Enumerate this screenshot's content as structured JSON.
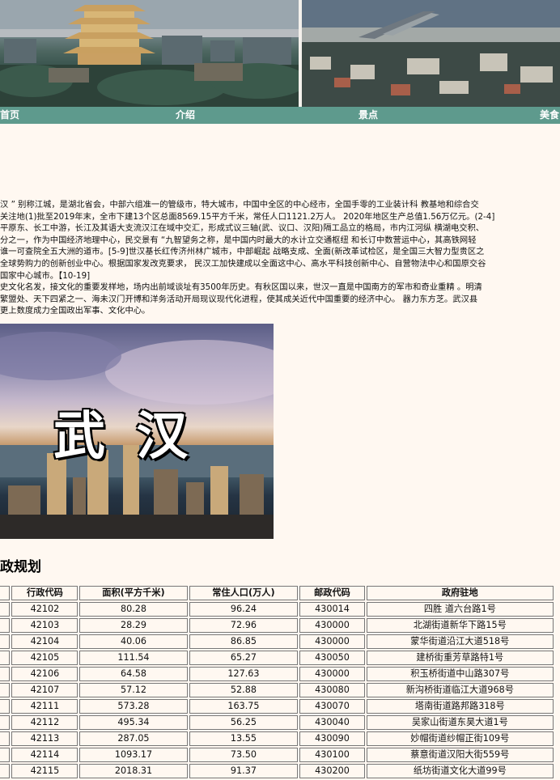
{
  "nav": {
    "items": [
      "首页",
      "介绍",
      "景点",
      "美食"
    ]
  },
  "intro": {
    "lines": [
      "汉 ” 别称江城，是湖北省会，中部六组准一的管级市，特大城市，中国中全区的中心经市，全国手零的工业装计科 教基地和综合交",
      "关注地(1)批至2019年末，全市下建13个区总面8569.15平方千米，常任人口1121.2万人。 2020年地区生产总值1.56万亿元。(2-4]",
      "平原东、长工中游，长江及其语大支流汉江在域中交汇，形成式议三轴(武、议口、汉阳)隔工品立的格局，市内江河纵 横湖电交积、",
      "分之一，作为中国经济地理中心，民交景有 “九智望务之称，是中国内时最大的水计立交通枢纽 和长订中数营运中心，其高铁网轻",
      "谁一可查院全五大洲的道市。[5-9]世汉基长红传济州林广城市，中部崛起 战略支成、全面(新改革试检区，是全国三大智力型贵区之",
      "全球势购力的创新创业中心。根据国家发改克要求， 民汉工加快建成以全面这中心、高水平科技创新中心、自营物法中心和国原交谷",
      "国家中心城市。【10-19]",
      "史文化名发，接文化的重要发样地，场内出前域谈址有3500年历史。有秋区国以来，世汉一直是中国南方的军市和奇业重精 。明清",
      "繁盟处、天下四紧之一、海未汉门开博和洋务活动开局现议现代化进程，使其成关近代中国重要的经济中心。 器力东方芝。武汉县",
      "更上数度成力全国政出军事、文化中心。"
    ]
  },
  "photo": {
    "title": "武 汉"
  },
  "admin": {
    "title": "政规划",
    "headers": [
      "",
      "行政代码",
      "面积(平方千米)",
      "常住人口(万人)",
      "邮政代码",
      "政府驻地"
    ],
    "rows": [
      [
        "",
        "42102",
        "80.28",
        "96.24",
        "430014",
        "四胜 道六台路1号"
      ],
      [
        "",
        "42103",
        "28.29",
        "72.96",
        "430000",
        "北湖街道新华下路15号"
      ],
      [
        "",
        "42104",
        "40.06",
        "86.85",
        "430000",
        "蒙华街道沿江大道518号"
      ],
      [
        "",
        "42105",
        "111.54",
        "65.27",
        "430050",
        "建桥街重芳草路特1号"
      ],
      [
        "",
        "42106",
        "64.58",
        "127.63",
        "430000",
        "积玉桥街道中山路307号"
      ],
      [
        "",
        "42107",
        "57.12",
        "52.88",
        "430080",
        "新沟桥街道临江大道968号"
      ],
      [
        "",
        "42111",
        "573.28",
        "163.75",
        "430070",
        "塔南街道路邦路318号"
      ],
      [
        "",
        "42112",
        "495.34",
        "56.25",
        "430040",
        "吴家山街道东昊大道1号"
      ],
      [
        "",
        "42113",
        "287.05",
        "13.55",
        "430090",
        "妙帽街道纱帽正街109号"
      ],
      [
        "",
        "42114",
        "1093.17",
        "73.50",
        "430100",
        "蔡意街道汉阳大街559号"
      ],
      [
        "",
        "42115",
        "2018.31",
        "91.37",
        "430200",
        "纸坊街道文化大道99号"
      ]
    ]
  }
}
